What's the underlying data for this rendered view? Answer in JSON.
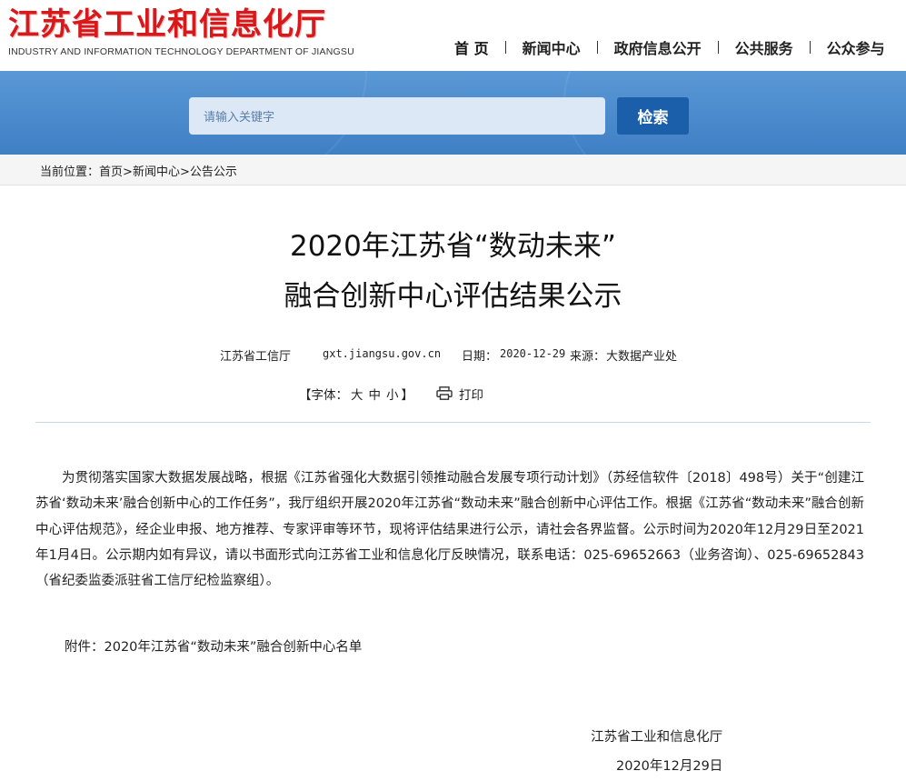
{
  "header": {
    "logo_cn": "江苏省工业和信息化厅",
    "logo_en": "INDUSTRY AND INFORMATION TECHNOLOGY DEPARTMENT OF JIANGSU",
    "nav": [
      "首 页",
      "新闻中心",
      "政府信息公开",
      "公共服务",
      "公众参与"
    ]
  },
  "search": {
    "placeholder": "请输入关键字",
    "button": "检索"
  },
  "breadcrumb": {
    "prefix": "当前位置：",
    "items": [
      "首页",
      "新闻中心",
      "公告公示"
    ],
    "sep": ">"
  },
  "article": {
    "title_line1": "2020年江苏省“数动未来”",
    "title_line2": "融合创新中心评估结果公示",
    "source_name": "江苏省工信厅",
    "site": "gxt.jiangsu.gov.cn",
    "date_label": "日期：",
    "date": "2020-12-29",
    "origin_label": "来源：",
    "origin": "大数据产业处",
    "font_label": "【字体：",
    "font_sizes": [
      "大",
      "中",
      "小"
    ],
    "font_close": "】",
    "print": "打印",
    "paragraph": "为贯彻落实国家大数据发展战略，根据《江苏省强化大数据引领推动融合发展专项行动计划》（苏经信软件〔2018〕498号）关于“创建江苏省‘数动未来’融合创新中心的工作任务”，我厅组织开展2020年江苏省“数动未来”融合创新中心评估工作。根据《江苏省“数动未来”融合创新中心评估规范》，经企业申报、地方推荐、专家评审等环节，现将评估结果进行公示，请社会各界监督。公示时间为2020年12月29日至2021年1月4日。公示期内如有异议，请以书面形式向江苏省工业和信息化厅反映情况，联系电话：025-69652663（业务咨询）、025-69652843（省纪委监委派驻省工信厅纪检监察组）。",
    "attachment": "附件：2020年江苏省“数动未来”融合创新中心名单",
    "signature": "江苏省工业和信息化厅",
    "sign_date": "2020年12月29日"
  }
}
